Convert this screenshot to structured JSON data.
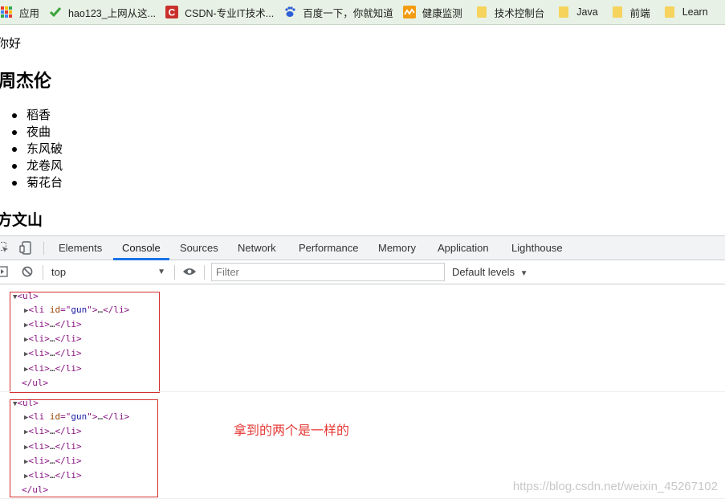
{
  "bookmarks": [
    {
      "label": "应用",
      "icon": "apps-grid-icon"
    },
    {
      "label": "hao123_上网从这...",
      "icon": "hao123-icon"
    },
    {
      "label": "CSDN-专业IT技术...",
      "icon": "csdn-icon"
    },
    {
      "label": "百度一下，你就知道",
      "icon": "baidu-icon"
    },
    {
      "label": "健康监测",
      "icon": "health-icon"
    },
    {
      "label": "技术控制台",
      "icon": "folder-icon"
    },
    {
      "label": "Java",
      "icon": "folder-icon"
    },
    {
      "label": "前端",
      "icon": "folder-icon"
    },
    {
      "label": "Learn",
      "icon": "folder-icon"
    }
  ],
  "page": {
    "greeting": "你好",
    "artist_heading": "周杰伦",
    "songs": [
      "稻香",
      "夜曲",
      "东风破",
      "龙卷风",
      "菊花台"
    ],
    "lyricist_heading": "方文山"
  },
  "devtools": {
    "tabs": [
      "Elements",
      "Console",
      "Sources",
      "Network",
      "Performance",
      "Memory",
      "Application",
      "Lighthouse"
    ],
    "active_tab": "Console",
    "context": "top",
    "filter_placeholder": "Filter",
    "levels": "Default levels"
  },
  "console": {
    "ul_open": "ul",
    "ul_close": "/ul",
    "first_li_attr": "id",
    "first_li_value": "gun",
    "ellipsis": "…",
    "li_tag": "li",
    "li_close": "/li"
  },
  "annotation": "拿到的两个是一样的",
  "watermark": "https://blog.csdn.net/weixin_45267102",
  "colors": {
    "accent": "#1a73e8",
    "annotation": "#e53935",
    "bookmark_bar": "#e8f1e5"
  }
}
